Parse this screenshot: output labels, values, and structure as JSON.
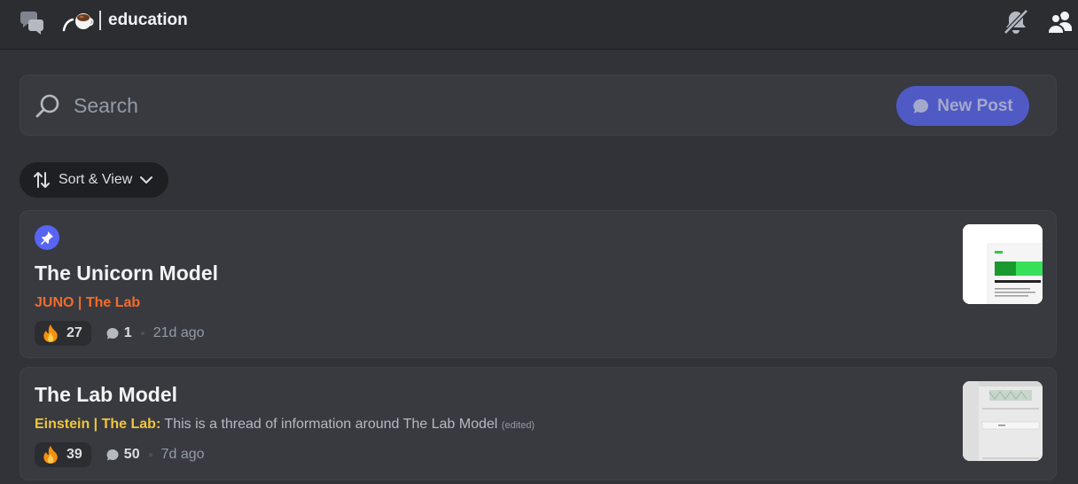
{
  "header": {
    "channel_name": "education",
    "icons": [
      "forum-icon",
      "coffee-emoji-icon",
      "notifications-muted-icon",
      "members-icon"
    ]
  },
  "search": {
    "placeholder": "Search",
    "new_post_label": "New Post"
  },
  "sort": {
    "label": "Sort & View"
  },
  "posts": [
    {
      "pinned": true,
      "title": "The Unicorn Model",
      "author": "JUNO | The Lab",
      "author_color": "#f26c2b",
      "preview": "",
      "edited": "",
      "reaction_emoji": "fire-icon",
      "reaction_count": "27",
      "reply_count": "1",
      "timestamp": "21d ago"
    },
    {
      "pinned": false,
      "title": "The Lab Model",
      "author": "Einstein | The Lab",
      "author_color": "#f0c53d",
      "author_suffix": ":",
      "preview": "This is a thread of information around The Lab Model",
      "edited": "(edited)",
      "reaction_emoji": "fire-icon",
      "reaction_count": "39",
      "reply_count": "50",
      "timestamp": "7d ago"
    }
  ],
  "colors": {
    "background": "#313338",
    "header": "#2b2d31",
    "accent": "#5865f2"
  }
}
